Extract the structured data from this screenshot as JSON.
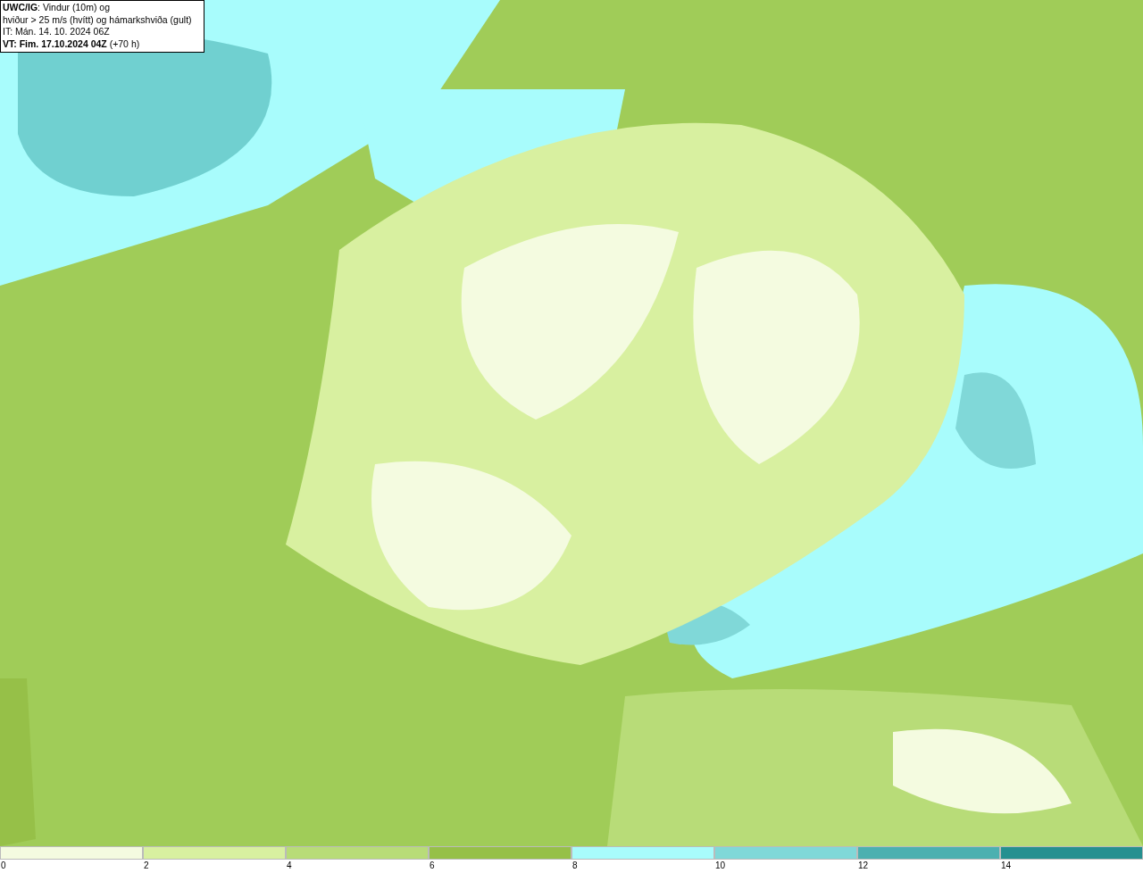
{
  "info_box": {
    "lines": [
      "**UWC/IG**: Vindur (10m) og",
      "hviður > 25 m/s (hvítt) og hámarkshviða (gult)",
      "IT: Mán. 14. 10. 2024 06Z",
      "**VT: Fim. 17.10.2024 04Z** (+70 h)"
    ]
  },
  "legend": {
    "bins": [
      {
        "label": "0",
        "color": "#f4fbe0"
      },
      {
        "label": "2",
        "color": "#d8f0a0"
      },
      {
        "label": "4",
        "color": "#b8dc78"
      },
      {
        "label": "6",
        "color": "#96c048"
      },
      {
        "label": "8",
        "color": "#a8fcfc"
      },
      {
        "label": "10",
        "color": "#80d8d8"
      },
      {
        "label": "12",
        "color": "#4cb0b0"
      },
      {
        "label": "14",
        "color": "#259090"
      }
    ]
  }
}
